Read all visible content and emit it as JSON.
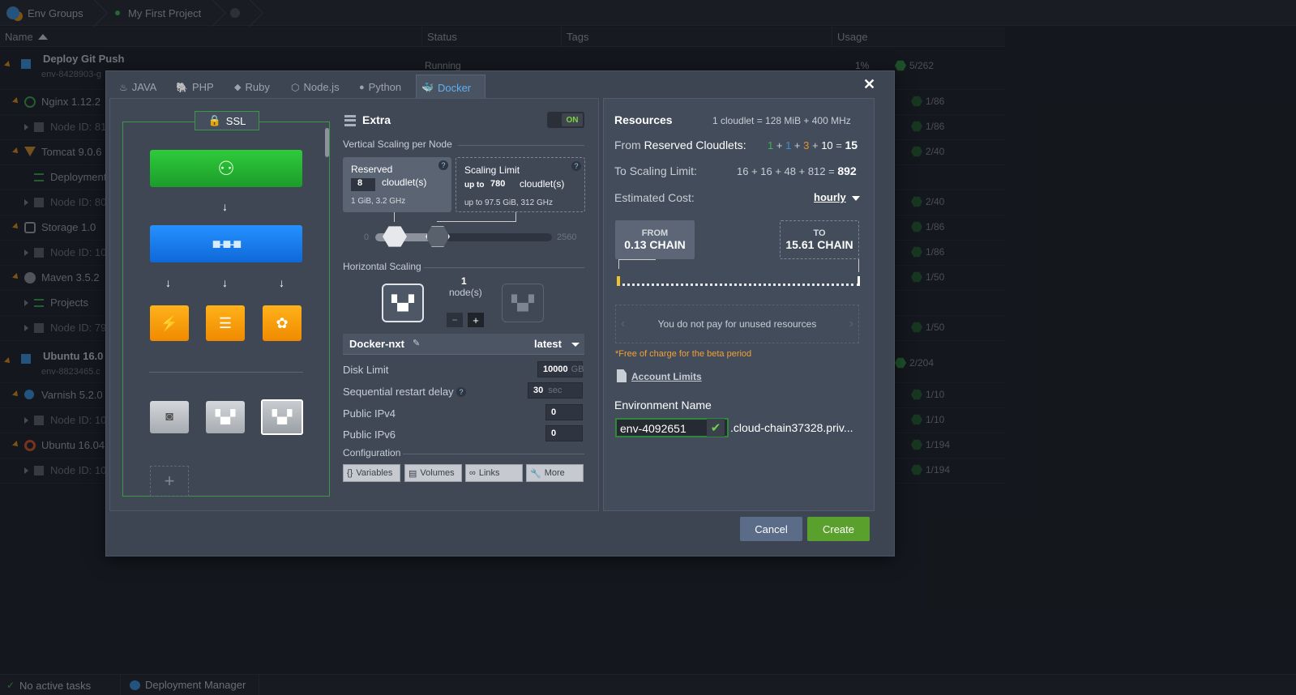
{
  "topbar": {
    "env_groups": "Env Groups",
    "project": "My First Project"
  },
  "columns": {
    "name": "Name",
    "status": "Status",
    "tags": "Tags",
    "usage": "Usage"
  },
  "rows": [
    {
      "name": "Deploy Git Push",
      "sub": "env-8428903-g",
      "status": "Running",
      "usage": "5/262",
      "pct": "1%"
    },
    {
      "name": "Nginx 1.12.2",
      "usage": "1/86"
    },
    {
      "name": "Node ID: 81",
      "usage": "1/86"
    },
    {
      "name": "Tomcat 9.0.6",
      "usage": "2/40"
    },
    {
      "name": "Deployment",
      "usage": ""
    },
    {
      "name": "Node ID: 80",
      "usage": "2/40"
    },
    {
      "name": "Storage 1.0",
      "usage": "1/86"
    },
    {
      "name": "Node ID: 10",
      "usage": "1/86"
    },
    {
      "name": "Maven 3.5.2",
      "usage": "1/50"
    },
    {
      "name": "Projects",
      "usage": ""
    },
    {
      "name": "Node ID: 79",
      "usage": "1/50"
    },
    {
      "name": "Ubuntu 16.0",
      "sub": "env-8823465.c",
      "usage": "2/204"
    },
    {
      "name": "Varnish 5.2.0",
      "usage": "1/10"
    },
    {
      "name": "Node ID: 10",
      "usage": "1/10"
    },
    {
      "name": "Ubuntu 16.04",
      "usage": "1/194"
    },
    {
      "name": "Node ID: 10",
      "usage": "1/194"
    }
  ],
  "dialog": {
    "tabs": [
      "JAVA",
      "PHP",
      "Ruby",
      "Node.js",
      "Python",
      "Docker"
    ],
    "ssl": "SSL",
    "extra": {
      "title": "Extra",
      "toggle": "ON"
    },
    "vertical": {
      "title": "Vertical Scaling per Node",
      "reserved_label": "Reserved",
      "reserved_value": "8",
      "reserved_unit": "cloudlet(s)",
      "reserved_spec": "1 GiB, 3.2 GHz",
      "limit_label": "Scaling Limit",
      "limit_prefix": "up to",
      "limit_value": "780",
      "limit_unit": "cloudlet(s)",
      "limit_spec": "up to 97.5 GiB, 312 GHz",
      "slider_min": "0",
      "slider_max": "2560"
    },
    "horizontal": {
      "title": "Horizontal Scaling",
      "count": "1",
      "unit": "node(s)"
    },
    "image": {
      "name": "Docker-nxt",
      "tag": "latest"
    },
    "disk": {
      "label": "Disk Limit",
      "value": "10000",
      "unit": "GB"
    },
    "restart": {
      "label": "Sequential restart delay",
      "value": "30",
      "unit": "sec"
    },
    "ipv4": {
      "label": "Public IPv4",
      "value": "0"
    },
    "ipv6": {
      "label": "Public IPv6",
      "value": "0"
    },
    "config": {
      "title": "Configuration",
      "buttons": [
        "Variables",
        "Volumes",
        "Links",
        "More"
      ]
    },
    "resources": {
      "title": "Resources",
      "cloudlet_def": "1 cloudlet = 128 MiB + 400 MHz",
      "reserved_label_pre": "From ",
      "reserved_label": "Reserved Cloudlets:",
      "reserved_parts": [
        "1",
        "1",
        "3",
        "10"
      ],
      "reserved_total": "15",
      "limit_label_pre": "To ",
      "limit_label": "Scaling Limit:",
      "limit_expr": "16 + 16 + 48 + 812 =",
      "limit_total": "892",
      "cost_label": "Estimated Cost:",
      "cost_period": "hourly",
      "from_label": "FROM",
      "from_value": "0.13 CHAIN",
      "to_label": "TO",
      "to_value": "15.61 CHAIN",
      "unused_note": "You do not pay for unused resources",
      "beta_note": "*Free of charge for the beta period",
      "account_limits": "Account Limits",
      "env_name_label": "Environment Name",
      "env_name": "env-4092651",
      "domain": ".cloud-chain37328.priv..."
    },
    "cancel": "Cancel",
    "create": "Create"
  },
  "bottombar": {
    "tasks": "No active tasks",
    "deploy": "Deployment Manager"
  },
  "colors": {
    "accent": "#5fb0f0",
    "create": "#5aa02c",
    "cancel": "#5b6c88",
    "on": "#7fd148"
  }
}
